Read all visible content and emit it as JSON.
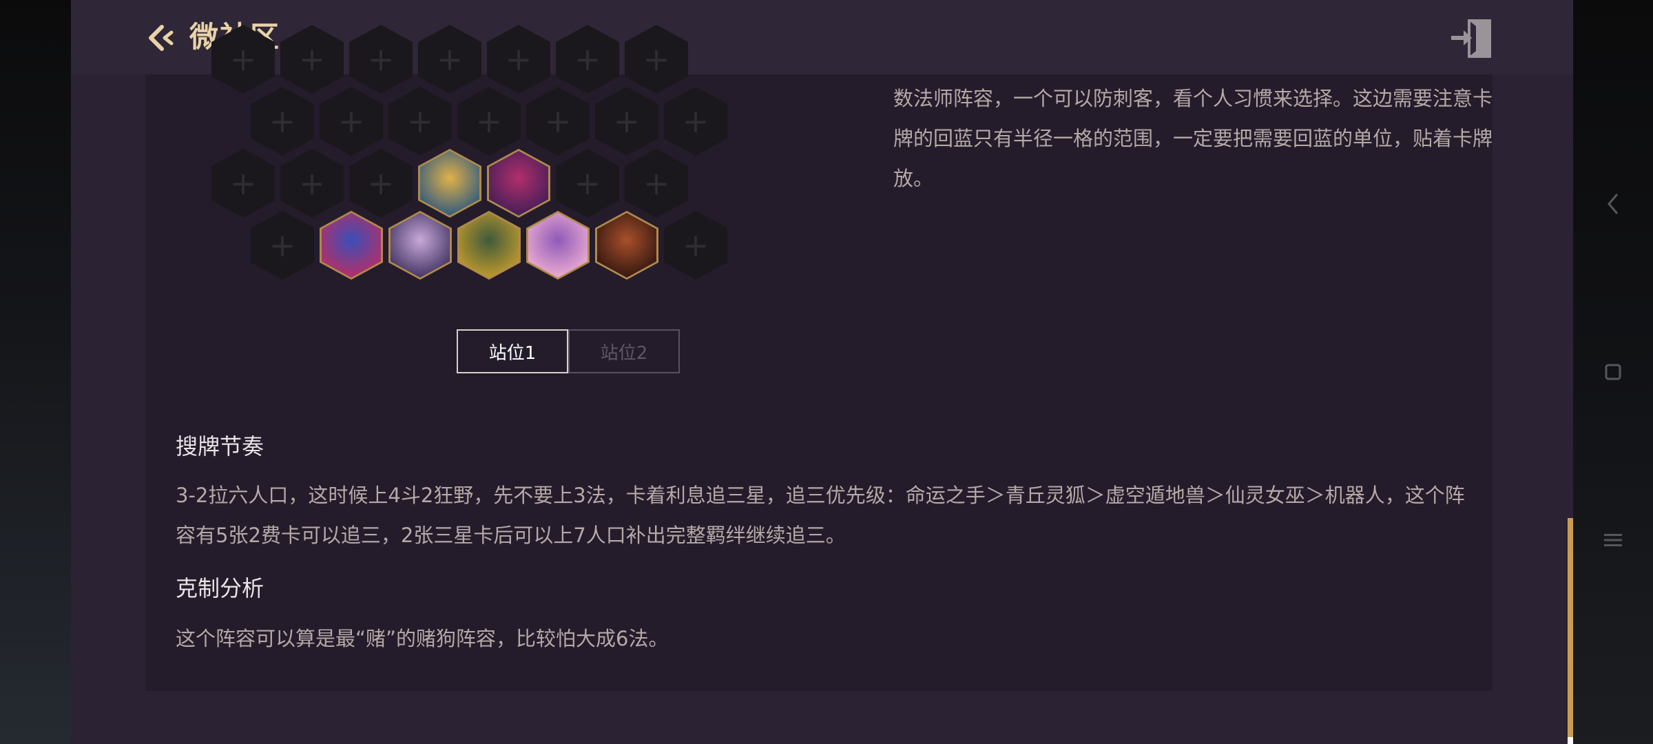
{
  "header": {
    "title": "微社区"
  },
  "board": {
    "rows": [
      [
        null,
        null,
        null,
        null,
        null,
        null,
        null
      ],
      [
        null,
        null,
        null,
        null,
        null,
        null,
        null
      ],
      [
        null,
        null,
        null,
        "robot",
        "void-burrow",
        null,
        null
      ],
      [
        null,
        "void-dragon",
        "fox-spirit",
        "twisted-fate",
        "witch",
        "monkey-king",
        null
      ]
    ]
  },
  "description": "数法师阵容，一个可以防刺客，看个人习惯来选择。这边需要注意卡牌的回蓝只有半径一格的范围，一定要把需要回蓝的单位，贴着卡牌放。",
  "tabs": [
    {
      "label": "站位1",
      "active": true
    },
    {
      "label": "站位2",
      "active": false
    }
  ],
  "sections": [
    {
      "title": "搜牌节奏",
      "text": "3-2拉六人口，这时候上4斗2狂野，先不要上3法，卡着利息追三星，追三优先级：命运之手＞青丘灵狐＞虚空遁地兽＞仙灵女巫＞机器人，这个阵容有5张2费卡可以追三，2张三星卡后可以上7人口补出完整羁绊继续追三。"
    },
    {
      "title": "克制分析",
      "text": "这个阵容可以算是最“赌”的赌狗阵容，比较怕大成6法。"
    }
  ],
  "colors": {
    "accent": "#e8d3a7",
    "scrollbar": "#c99e52"
  },
  "nav": {
    "icons": [
      "back-chevron-icon",
      "recent-apps-square-icon",
      "menu-lines-icon"
    ]
  }
}
